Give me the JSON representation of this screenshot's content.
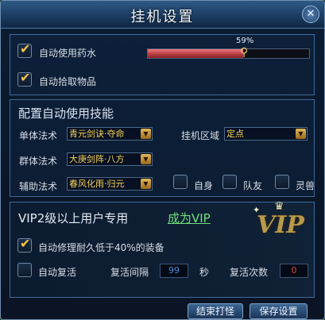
{
  "window": {
    "title": "挂机设置",
    "close_label": "✕"
  },
  "potion": {
    "auto_use_potion_label": "自动使用药水",
    "auto_use_potion_checked": true,
    "threshold_label": "59%",
    "threshold_fraction": 0.59
  },
  "pickup": {
    "label": "自动拾取物品",
    "checked": true
  },
  "skills": {
    "heading": "配置自动使用技能",
    "single_label": "单体法术",
    "single_value": "青元剑诀·夺命",
    "group_label": "群体法术",
    "group_value": "大庚剑阵·八方",
    "assist_label": "辅助法术",
    "assist_value": "春风化雨·归元",
    "zone_label": "挂机区域",
    "zone_value": "定点",
    "self_label": "自身",
    "team_label": "队友",
    "pet_label": "灵兽",
    "self_checked": false,
    "team_checked": false,
    "pet_checked": false
  },
  "vip": {
    "heading": "VIP2级以上用户专用",
    "become_link": "成为VIP",
    "logo_text": "VIP",
    "repair_label": "自动修理耐久低于40%的装备",
    "repair_checked": true,
    "revive_label": "自动复活",
    "revive_checked": false,
    "interval_label": "复活间隔",
    "interval_value": "99",
    "interval_unit": "秒",
    "count_label": "复活次数",
    "count_value": "0"
  },
  "buttons": {
    "stop": "结束打怪",
    "save": "保存设置"
  },
  "colors": {
    "accent_gold": "#f7c34a",
    "vip_green": "#6fe07a",
    "bar_red": "#d05054"
  }
}
